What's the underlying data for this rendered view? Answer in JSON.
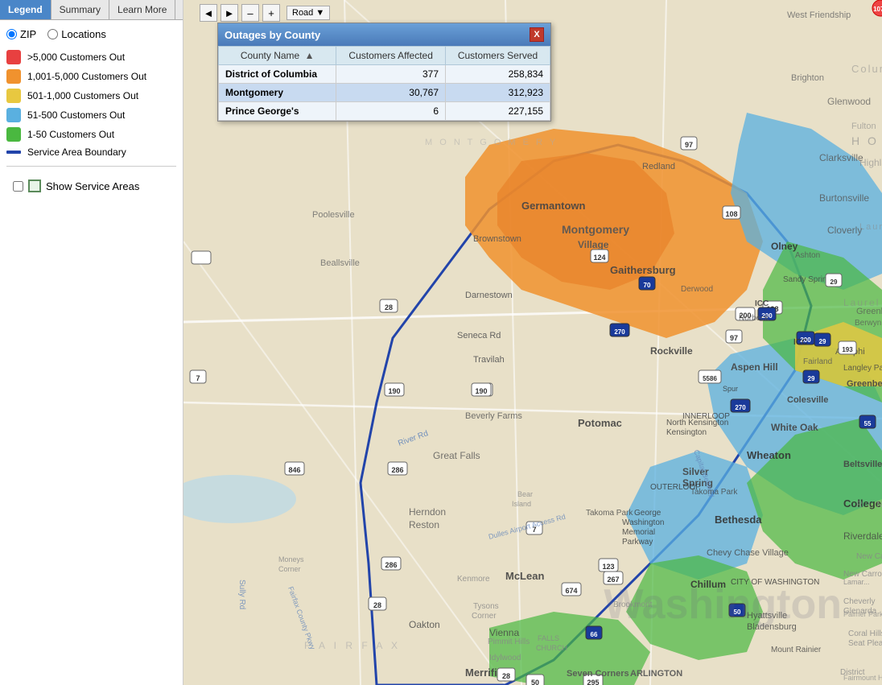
{
  "tabs": {
    "items": [
      {
        "id": "legend",
        "label": "Legend",
        "active": true
      },
      {
        "id": "summary",
        "label": "Summary",
        "active": false
      },
      {
        "id": "learn",
        "label": "Learn More",
        "active": false
      }
    ]
  },
  "legend": {
    "radio_zip_label": "ZIP",
    "radio_locations_label": "Locations",
    "items": [
      {
        "color": "#e84040",
        "label": ">5,000 Customers Out"
      },
      {
        "color": "#f0922e",
        "label": "1,001-5,000 Customers Out"
      },
      {
        "color": "#e8c840",
        "label": "501-1,000 Customers Out"
      },
      {
        "color": "#5ab0e0",
        "label": "51-500 Customers Out"
      },
      {
        "color": "#4ab840",
        "label": "1-50 Customers Out"
      },
      {
        "type": "line",
        "label": "Service Area Boundary"
      }
    ],
    "show_service_areas_label": "Show Service Areas"
  },
  "popup": {
    "title": "Outages by County",
    "close_label": "X",
    "table": {
      "headers": [
        "County Name",
        "Customers Affected",
        "Customers Served"
      ],
      "rows": [
        {
          "county": "District of Columbia",
          "affected": "377",
          "served": "258,834",
          "selected": false
        },
        {
          "county": "Montgomery",
          "affected": "30,767",
          "served": "312,923",
          "selected": true
        },
        {
          "county": "Prince George's",
          "affected": "6",
          "served": "227,155",
          "selected": false
        }
      ]
    }
  },
  "map": {
    "nav_left": "◄",
    "nav_right": "►",
    "zoom_out": "–",
    "zoom_in": "+",
    "road_label": "Road ▼",
    "watermark": "Washington"
  }
}
